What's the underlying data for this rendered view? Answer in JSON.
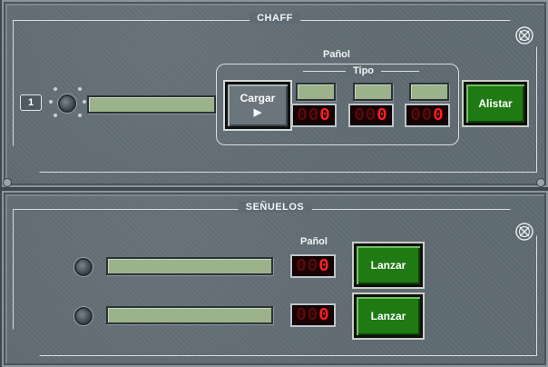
{
  "chaff": {
    "title": "CHAFF",
    "counter": "1",
    "panol_label": "Pañol",
    "tipo_label": "Tipo",
    "cargar_label": "Cargar",
    "cargar_arrow": "▶",
    "alistar_label": "Alistar",
    "main_display": "",
    "tipo_slots": [
      {
        "display": "",
        "digits_dim": "00",
        "digits_lit": "0"
      },
      {
        "display": "",
        "digits_dim": "00",
        "digits_lit": "0"
      },
      {
        "display": "",
        "digits_dim": "00",
        "digits_lit": "0"
      }
    ]
  },
  "senuelos": {
    "title": "SEÑUELOS",
    "panol_label": "Pañol",
    "rows": [
      {
        "display": "",
        "digits_dim": "00",
        "digits_lit": "0",
        "lanzar_label": "Lanzar"
      },
      {
        "display": "",
        "digits_dim": "00",
        "digits_lit": "0",
        "lanzar_label": "Lanzar"
      }
    ]
  },
  "icons": {
    "close": "close-icon",
    "led": "indicator-led-icon",
    "arrow": "play-arrow-icon"
  },
  "colors": {
    "panel": "#5f6a72",
    "lcd": "#9cb28a",
    "led_digit": "#ff2020",
    "button_green": "#1f7a13"
  }
}
